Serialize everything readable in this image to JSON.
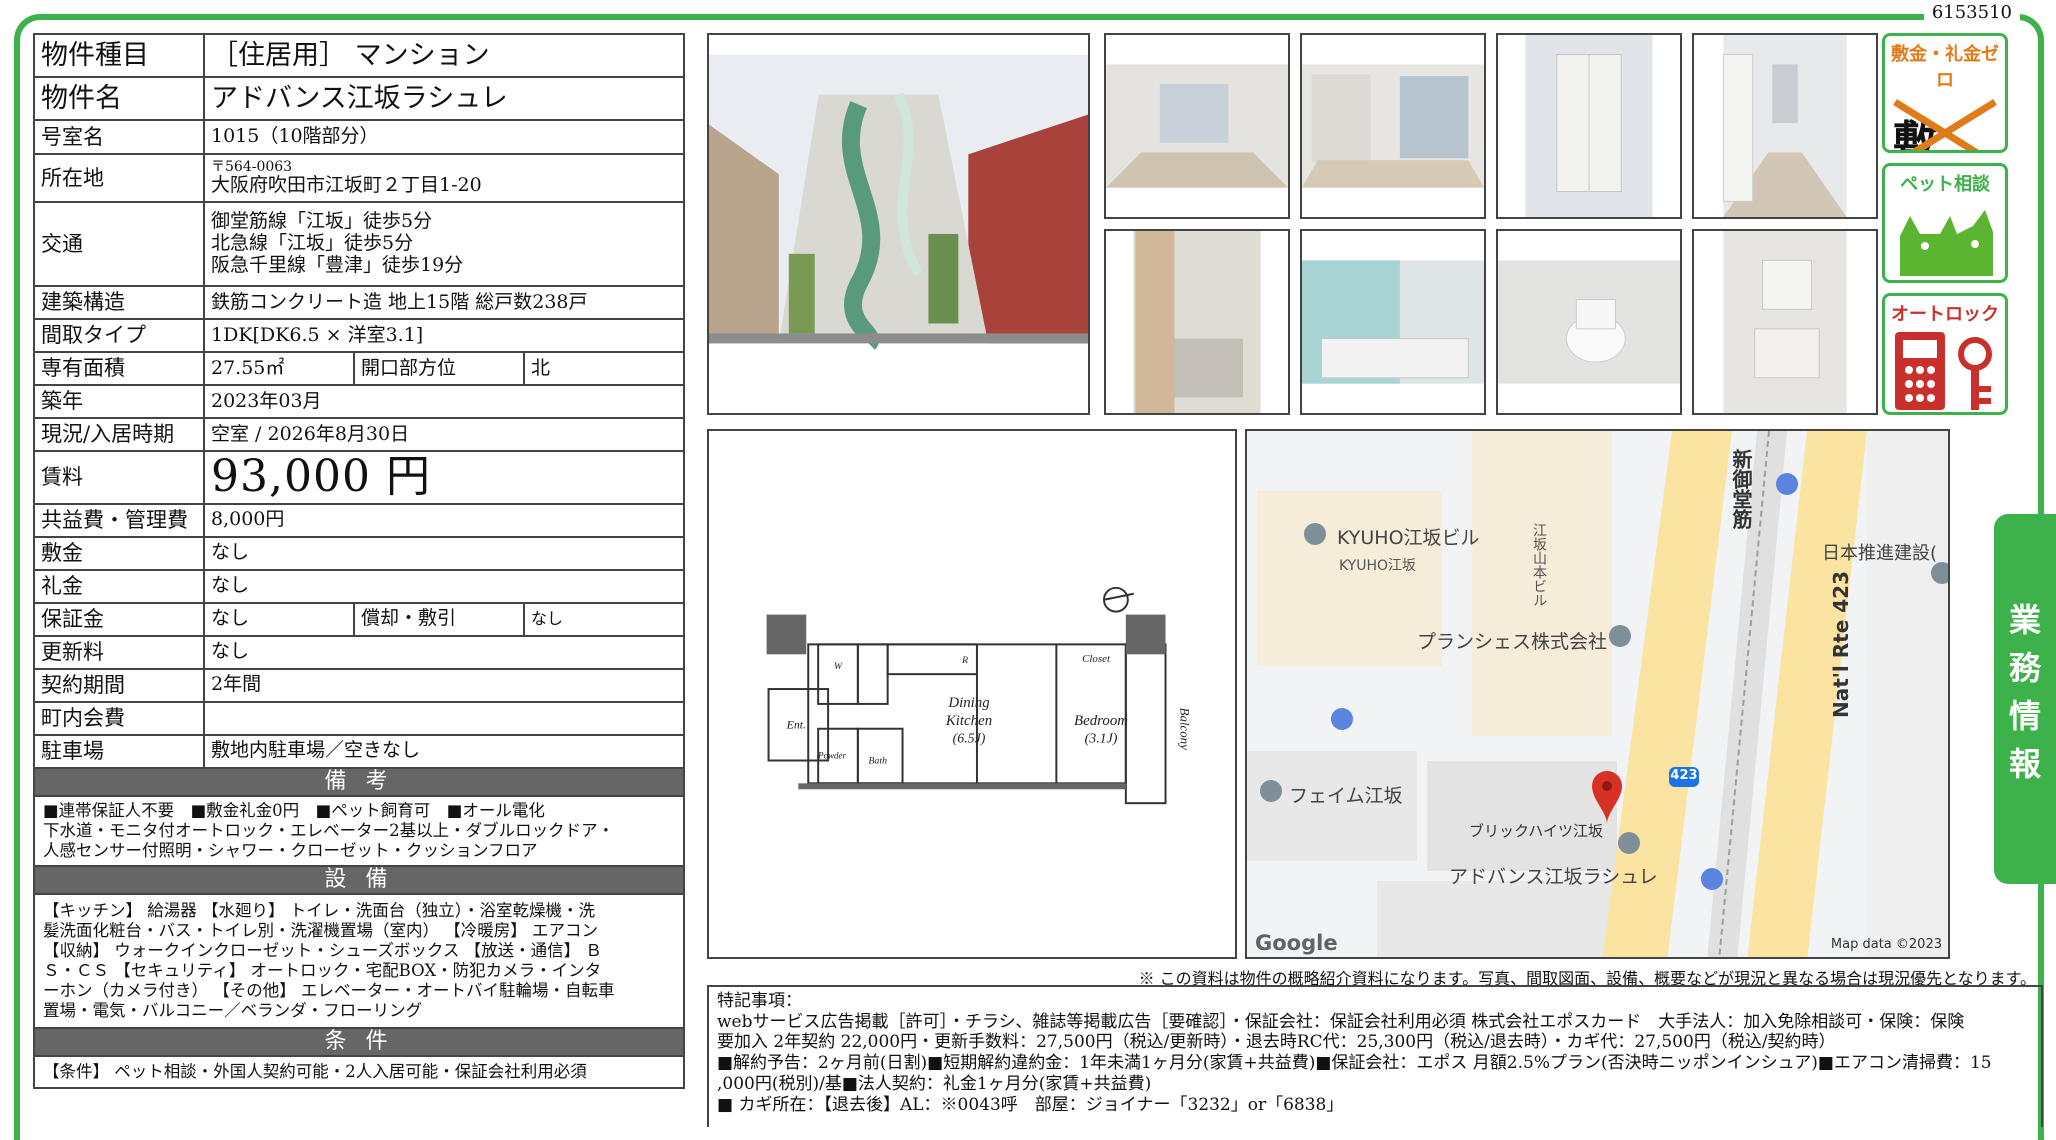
{
  "doc_id": "6153510",
  "props": {
    "type_label": "物件種目",
    "type_value": "［住居用］ マンション",
    "name_label": "物件名",
    "name_value": "アドバンス江坂ラシュレ",
    "room_label": "号室名",
    "room_value": "1015（10階部分）",
    "address_label": "所在地",
    "postal": "〒564-0063",
    "address": "大阪府吹田市江坂町２丁目1-20",
    "access_label": "交通",
    "access": [
      "御堂筋線「江坂」徒歩5分",
      "北急線「江坂」徒歩5分",
      "阪急千里線「豊津」徒歩19分"
    ],
    "structure_label": "建築構造",
    "structure_value": "鉄筋コンクリート造 地上15階 総戸数238戸",
    "layout_label": "間取タイプ",
    "layout_value": "1DK[DK6.5 × 洋室3.1]",
    "area_label": "専有面積",
    "area_value": "27.55㎡",
    "direction_label": "開口部方位",
    "direction_value": "北",
    "built_label": "築年",
    "built_value": "2023年03月",
    "status_label": "現況/入居時期",
    "status_value": "空室 / 2026年8月30日",
    "rent_label": "賃料",
    "rent_value": "93,000 円",
    "fee_label": "共益費・管理費",
    "fee_value": "8,000円",
    "shikikin_label": "敷金",
    "shikikin_value": "なし",
    "reikin_label": "礼金",
    "reikin_value": "なし",
    "deposit_label": "保証金",
    "deposit_value": "なし",
    "amort_label": "償却・敷引",
    "amort_value": "なし",
    "renewal_label": "更新料",
    "renewal_value": "なし",
    "term_label": "契約期間",
    "term_value": "2年間",
    "town_label": "町内会費",
    "town_value": "",
    "parking_label": "駐車場",
    "parking_value": "敷地内駐車場／空きなし",
    "remarks_header": "備 考",
    "remarks": [
      "■連帯保証人不要　■敷金礼金0円　■ペット飼育可　■オール電化",
      "下水道・モニタ付オートロック・エレベーター2基以上・ダブルロックドア・",
      "人感センサー付照明・シャワー・クローゼット・クッションフロア"
    ],
    "equip_header": "設 備",
    "equip": [
      "【キッチン】 給湯器 【水廻り】 トイレ・洗面台（独立）・浴室乾燥機・洗",
      "髪洗面化粧台・バス・トイレ別・洗濯機置場（室内） 【冷暖房】 エアコン",
      "【収納】 ウォークインクローゼット・シューズボックス 【放送・通信】 Ｂ",
      "Ｓ・ＣＳ 【セキュリティ】 オートロック・宅配BOX・防犯カメラ・インタ",
      "ーホン（カメラ付き） 【その他】 エレベーター・オートバイ駐輪場・自転車",
      "置場・電気・バルコニー／ベランダ・フローリング"
    ],
    "cond_header": "条 件",
    "cond_value": "【条件】 ペット相談・外国人契約可能・2人入居可能・保証会社利用必須"
  },
  "badges": {
    "zero": "敷金・礼金ゼロ",
    "zero_chars": "敷 礼",
    "pet": "ペット相談",
    "lock": "オートロック"
  },
  "sidetab": [
    "業",
    "務",
    "情",
    "報"
  ],
  "floorplan": {
    "dining": "Dining",
    "kitchen": "Kitchen",
    "dining_size": "(6.5J)",
    "bedroom": "Bedroom",
    "bedroom_size": "(3.1J)",
    "closet": "Closet",
    "balcony": "Balcony",
    "entrance": "Ent.",
    "powder": "Powder",
    "bath": "Bath",
    "w": "W",
    "r": "R"
  },
  "map": {
    "kyuho_bldg": "KYUHO江坂ビル",
    "kyuho": "KYUHO江坂",
    "esaka_yamato": "江坂山本ビル",
    "planches": "プランシェス株式会社",
    "fame": "フェイム江坂",
    "brick": "ブリックハイツ江坂",
    "advance": "アドバンス江坂ラシュレ",
    "shinmido": "新御堂筋",
    "nipponsuishin": "日本推進建設(",
    "rte": "Nat'l Rte 423",
    "route_num": "423",
    "google": "Google",
    "mapdata": "Map data ©2023"
  },
  "note": "※ この資料は物件の概略紹介資料になります。写真、間取図面、設備、概要などが現況と異なる場合は現況優先となります。",
  "remarks_box": [
    "特記事項：",
    "webサービス広告掲載［許可］・チラシ、雑誌等掲載広告［要確認］・保証会社：保証会社利用必須 株式会社エポスカード　大手法人：加入免除相談可・保険：保険",
    "要加入 2年契約 22,000円・更新手数料：27,500円（税込/更新時）・退去時RC代：25,300円（税込/退去時）・カギ代：27,500円（税込/契約時）",
    "■解約予告：2ヶ月前(日割)■短期解約違約金：1年未満1ヶ月分(家賃+共益費)■保証会社：エポス 月額2.5%プラン(否決時ニッポンインシュア)■エアコン清掃費：15",
    ",000円(税別)/基■法人契約：礼金1ヶ月分(家賃+共益費)",
    "■ カギ所在：【退去後】AL：※0043呼　部屋：ジョイナー「3232」or「6838」"
  ]
}
